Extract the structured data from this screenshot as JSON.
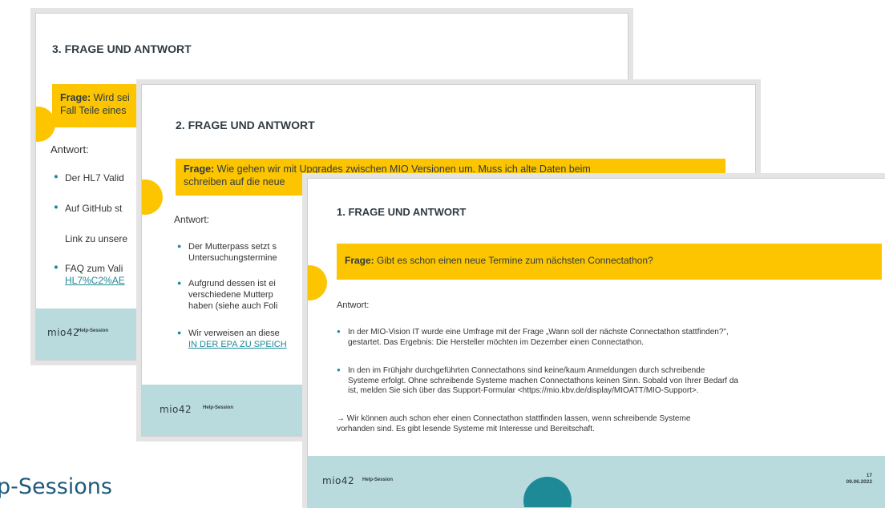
{
  "page_caption": "p-Sessions",
  "footer_label": "Help-Session",
  "logo_text": "mio42",
  "slide3": {
    "title": "3. FRAGE UND ANTWORT",
    "frage_label": "Frage:",
    "frage_text_line1": " Wird sei",
    "frage_text_line2": "Fall Teile eines",
    "antwort": "Antwort:",
    "bullet1": "Der HL7 Valid",
    "bullet2": "Auf GitHub st",
    "plain1": "Link zu unsere",
    "bullet3": "FAQ zum Vali",
    "bullet3_link": "HL7%C2%AE"
  },
  "slide2": {
    "title": "2. FRAGE UND ANTWORT",
    "frage_label": "Frage:",
    "frage_text_line1": " Wie gehen wir mit Upgrades zwischen MIO Versionen um. Muss ich alte Daten beim",
    "frage_text_line2": "schreiben auf die neue",
    "antwort": "Antwort:",
    "bullet1_line1": "Der Mutterpass setzt s",
    "bullet1_line2": "Untersuchungstermine",
    "bullet2_line1": "Aufgrund dessen ist ei",
    "bullet2_line2": "verschiedene Mutterp",
    "bullet2_line3": "haben (siehe auch Foli",
    "bullet3_line1": "Wir verweisen an diese",
    "bullet3_link": "IN DER EPA ZU SPEICH"
  },
  "slide1": {
    "title": "1. FRAGE UND ANTWORT",
    "frage_label": "Frage:",
    "frage_text": " Gibt es schon einen neue Termine zum nächsten Connectathon?",
    "antwort": "Antwort:",
    "bullet1_line1": "In der MIO-Vision IT wurde eine Umfrage mit der Frage „Wann soll der nächste Connectathon stattfinden?\",",
    "bullet1_line2": "gestartet. Das Ergebnis: Die Hersteller möchten im Dezember einen Connectathon.",
    "bullet2_line1": "In den im Frühjahr durchgeführten Connectathons sind keine/kaum Anmeldungen durch schreibende",
    "bullet2_line2": "Systeme erfolgt. Ohne schreibende Systeme machen Connectathons keinen Sinn. Sobald von Ihrer Bedarf da",
    "bullet2_line3": "ist, melden Sie sich über das Support-Formular <https://mio.kbv.de/display/MIOATT/MIO-Support>.",
    "arrow_line1": "→ Wir können auch schon eher einen Connectathon stattfinden lassen, wenn schreibende Systeme",
    "arrow_line2": "vorhanden sind. Es gibt lesende Systeme mit Interesse und Bereitschaft.",
    "page_number": "17",
    "date": "09.06.2022"
  },
  "colors": {
    "accent_yellow": "#fcc500",
    "teal": "#1e8a98",
    "footer_bg": "#b9dbdd",
    "title": "#2f3b44"
  }
}
